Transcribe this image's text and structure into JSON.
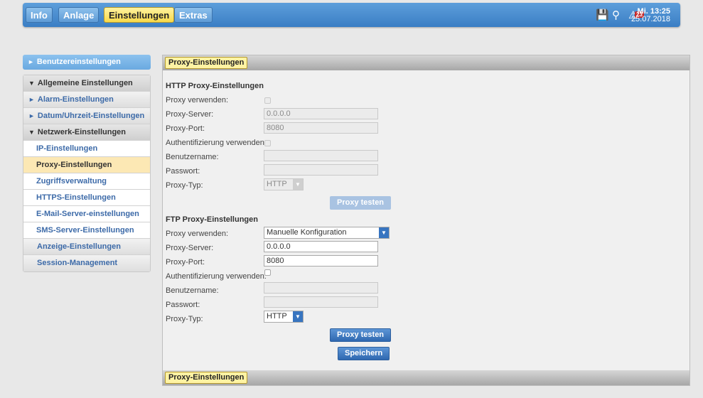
{
  "topnav": {
    "tabs": [
      {
        "label": "Info"
      },
      {
        "label": "Anlage"
      },
      {
        "label": "Einstellungen"
      },
      {
        "label": "Extras"
      }
    ],
    "badge_count": "23",
    "time": "Mi. 13:25",
    "date": "25.07.2018"
  },
  "sidebar": {
    "user_settings": "Benutzereinstellungen",
    "general": "Allgemeine Einstellungen",
    "alarm": "Alarm-Einstellungen",
    "datetime": "Datum/Uhrzeit-Einstellungen",
    "network": "Netzwerk-Einstellungen",
    "network_items": [
      "IP-Einstellungen",
      "Proxy-Einstellungen",
      "Zugriffsverwaltung",
      "HTTPS-Einstellungen",
      "E-Mail-Server-einstellungen",
      "SMS-Server-Einstellungen"
    ],
    "display": "Anzeige-Einstellungen",
    "session": "Session-Management"
  },
  "panel": {
    "title": "Proxy-Einstellungen",
    "footer_title": "Proxy-Einstellungen",
    "http": {
      "title": "HTTP Proxy-Einstellungen",
      "use_proxy_label": "Proxy verwenden:",
      "server_label": "Proxy-Server:",
      "server_value": "0.0.0.0",
      "port_label": "Proxy-Port:",
      "port_value": "8080",
      "auth_label": "Authentifizierung verwenden:",
      "user_label": "Benutzername:",
      "password_label": "Passwort:",
      "type_label": "Proxy-Typ:",
      "type_value": "HTTP",
      "test_button": "Proxy testen"
    },
    "ftp": {
      "title": "FTP Proxy-Einstellungen",
      "use_proxy_label": "Proxy verwenden:",
      "use_proxy_value": "Manuelle Konfiguration",
      "server_label": "Proxy-Server:",
      "server_value": "0.0.0.0",
      "port_label": "Proxy-Port:",
      "port_value": "8080",
      "auth_label": "Authentifizierung verwenden:",
      "user_label": "Benutzername:",
      "password_label": "Passwort:",
      "type_label": "Proxy-Typ:",
      "type_value": "HTTP",
      "test_button": "Proxy testen",
      "save_button": "Speichern"
    }
  }
}
